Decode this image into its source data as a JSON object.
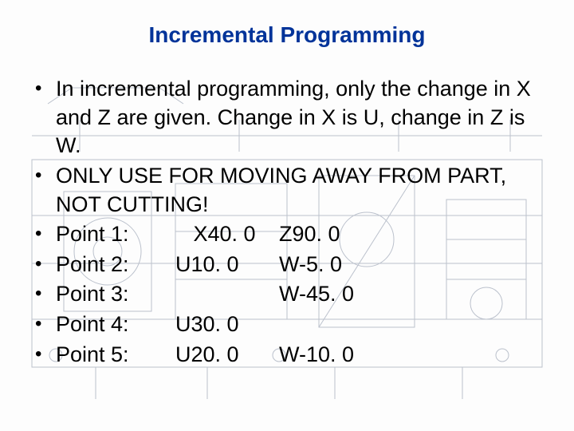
{
  "title": "Incremental Programming",
  "bullets": {
    "intro": "In incremental programming, only the change in X and Z are given.  Change in X is U, change in Z is W.",
    "warning": "ONLY USE FOR MOVING AWAY FROM PART, NOT CUTTING!"
  },
  "points": [
    {
      "label": "Point 1:",
      "col1": "   X40. 0",
      "col2": "Z90. 0"
    },
    {
      "label": "Point 2:",
      "col1": "U10. 0",
      "col2": "W-5. 0"
    },
    {
      "label": "Point 3:",
      "col1": "",
      "col2": "W-45. 0"
    },
    {
      "label": "Point 4:",
      "col1": "U30. 0",
      "col2": ""
    },
    {
      "label": "Point 5:",
      "col1": "U20. 0",
      "col2": "W-10. 0"
    }
  ]
}
